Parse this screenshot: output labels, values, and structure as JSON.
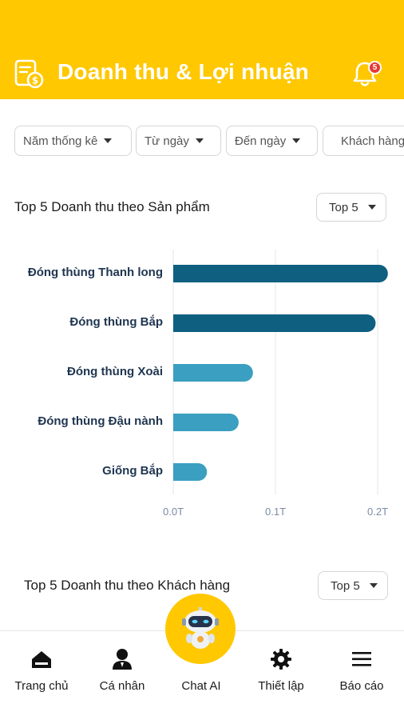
{
  "header": {
    "title": "Doanh thu & Lợi nhuận",
    "notification_count": "5"
  },
  "filters": [
    {
      "label": "Năm thống kê"
    },
    {
      "label": "Từ ngày"
    },
    {
      "label": "Đến ngày"
    },
    {
      "label": "Khách hàng"
    }
  ],
  "section_products": {
    "title": "Top 5 Doanh thu theo Sản phẩm",
    "top_select": "Top 5"
  },
  "section_customers": {
    "title": "Top 5 Doanh thu theo Khách hàng",
    "top_select": "Top 5"
  },
  "chart_data": {
    "type": "bar",
    "orientation": "horizontal",
    "categories": [
      "Đóng thùng Thanh long",
      "Đóng thùng Bắp",
      "Đóng thùng Xoài",
      "Đóng thùng Đậu nành",
      "Giống Bắp"
    ],
    "values": [
      0.21,
      0.198,
      0.078,
      0.064,
      0.033
    ],
    "xlim": [
      0,
      0.2
    ],
    "x_ticks": [
      "0.0T",
      "0.1T",
      "0.2T"
    ],
    "colors": [
      "#0e5f80",
      "#0e5f80",
      "#3a9fc0",
      "#3a9fc0",
      "#3a9fc0"
    ],
    "grid": true
  },
  "nav": {
    "items": [
      {
        "label": "Trang chủ",
        "icon": "home-icon"
      },
      {
        "label": "Cá nhân",
        "icon": "person-icon"
      },
      {
        "label": "Chat AI",
        "icon": "robot-icon"
      },
      {
        "label": "Thiết lập",
        "icon": "gear-icon"
      },
      {
        "label": "Báo cáo",
        "icon": "menu-icon"
      }
    ]
  },
  "colors": {
    "brand": "#ffc800",
    "bar_dark": "#0e5f80",
    "bar_light": "#3a9fc0",
    "badge": "#e53935"
  }
}
